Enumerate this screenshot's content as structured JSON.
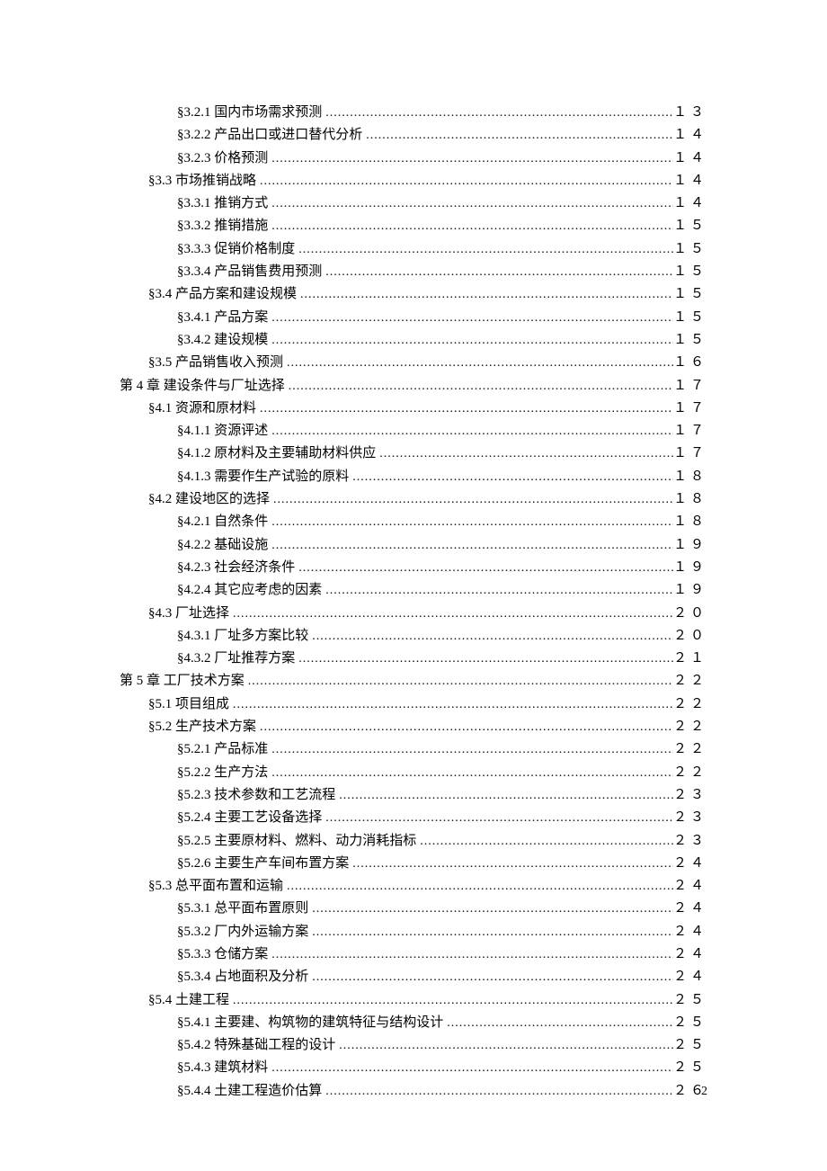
{
  "footer_page": "2",
  "entries": [
    {
      "indent": 2,
      "label": "§3.2.1  国内市场需求预测",
      "page": "１３"
    },
    {
      "indent": 2,
      "label": "§3.2.2  产品出口或进口替代分析",
      "page": "１４"
    },
    {
      "indent": 2,
      "label": "§3.2.3  价格预测",
      "page": "１４"
    },
    {
      "indent": 1,
      "label": "§3.3  市场推销战略",
      "page": "１４"
    },
    {
      "indent": 2,
      "label": "§3.3.1  推销方式",
      "page": "１４"
    },
    {
      "indent": 2,
      "label": "§3.3.2  推销措施",
      "page": "１５"
    },
    {
      "indent": 2,
      "label": "§3.3.3  促销价格制度",
      "page": "１５"
    },
    {
      "indent": 2,
      "label": "§3.3.4  产品销售费用预测",
      "page": "１５"
    },
    {
      "indent": 1,
      "label": "§3.4  产品方案和建设规模",
      "page": "１５"
    },
    {
      "indent": 2,
      "label": "§3.4.1  产品方案",
      "page": "１５"
    },
    {
      "indent": 2,
      "label": "§3.4.2  建设规模",
      "page": "１５"
    },
    {
      "indent": 1,
      "label": "§3.5  产品销售收入预测",
      "page": "１６"
    },
    {
      "indent": 0,
      "label": "第 4 章  建设条件与厂址选择",
      "page": "１７"
    },
    {
      "indent": 1,
      "label": "§4.1  资源和原材料",
      "page": "１７"
    },
    {
      "indent": 2,
      "label": "§4.1.1  资源评述",
      "page": "１７"
    },
    {
      "indent": 2,
      "label": "§4.1.2  原材料及主要辅助材料供应",
      "page": "１７"
    },
    {
      "indent": 2,
      "label": "§4.1.3  需要作生产试验的原料",
      "page": "１８"
    },
    {
      "indent": 1,
      "label": "§4.2  建设地区的选择",
      "page": "１８"
    },
    {
      "indent": 2,
      "label": "§4.2.1  自然条件",
      "page": "１８"
    },
    {
      "indent": 2,
      "label": "§4.2.2  基础设施",
      "page": "１９"
    },
    {
      "indent": 2,
      "label": "§4.2.3  社会经济条件",
      "page": "１９"
    },
    {
      "indent": 2,
      "label": "§4.2.4  其它应考虑的因素",
      "page": "１９"
    },
    {
      "indent": 1,
      "label": "§4.3  厂址选择",
      "page": "２０"
    },
    {
      "indent": 2,
      "label": "§4.3.1  厂址多方案比较",
      "page": "２０"
    },
    {
      "indent": 2,
      "label": "§4.3.2  厂址推荐方案",
      "page": "２１"
    },
    {
      "indent": 0,
      "label": "第 5 章  工厂技术方案",
      "page": "２２"
    },
    {
      "indent": 1,
      "label": "§5.1  项目组成",
      "page": "２２"
    },
    {
      "indent": 1,
      "label": "§5.2  生产技术方案",
      "page": "２２"
    },
    {
      "indent": 2,
      "label": "§5.2.1  产品标准",
      "page": "２２"
    },
    {
      "indent": 2,
      "label": "§5.2.2  生产方法",
      "page": "２２"
    },
    {
      "indent": 2,
      "label": "§5.2.3  技术参数和工艺流程",
      "page": "２３"
    },
    {
      "indent": 2,
      "label": "§5.2.4  主要工艺设备选择",
      "page": "２３"
    },
    {
      "indent": 2,
      "label": "§5.2.5  主要原材料、燃料、动力消耗指标",
      "page": "２３"
    },
    {
      "indent": 2,
      "label": "§5.2.6  主要生产车间布置方案",
      "page": "２４"
    },
    {
      "indent": 1,
      "label": "§5.3  总平面布置和运输",
      "page": "２４"
    },
    {
      "indent": 2,
      "label": "§5.3.1  总平面布置原则",
      "page": "２４"
    },
    {
      "indent": 2,
      "label": "§5.3.2  厂内外运输方案",
      "page": "２４"
    },
    {
      "indent": 2,
      "label": "§5.3.3  仓储方案",
      "page": "２４"
    },
    {
      "indent": 2,
      "label": "§5.3.4  占地面积及分析",
      "page": "２４"
    },
    {
      "indent": 1,
      "label": "§5.4  土建工程",
      "page": "２５"
    },
    {
      "indent": 2,
      "label": "§5.4.1  主要建、构筑物的建筑特征与结构设计",
      "page": "２５"
    },
    {
      "indent": 2,
      "label": "§5.4.2  特殊基础工程的设计",
      "page": "２５"
    },
    {
      "indent": 2,
      "label": "§5.4.3  建筑材料",
      "page": "２５"
    },
    {
      "indent": 2,
      "label": "§5.4.4  土建工程造价估算",
      "page": "２６"
    }
  ]
}
